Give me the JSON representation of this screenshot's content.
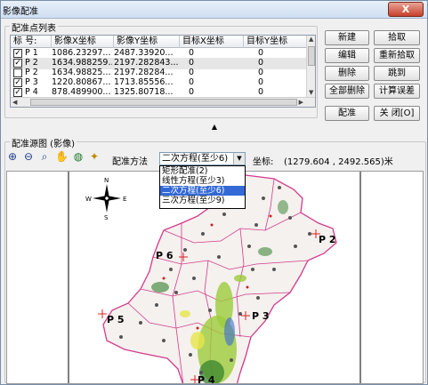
{
  "window": {
    "title": "影像配准",
    "close_label": "X"
  },
  "points_group": {
    "title": "配准点列表",
    "columns": [
      "标 号:",
      "影像X坐标",
      "影像Y坐标",
      "目标X坐标",
      "目标Y坐标"
    ],
    "rows": [
      {
        "checked": true,
        "id": "P 1",
        "img_x": "1086.23297...",
        "img_y": "2487.33920...",
        "tgt_x": "0",
        "tgt_y": "0",
        "selected": false
      },
      {
        "checked": true,
        "id": "P 2",
        "img_x": "1634.988259...",
        "img_y": "2197.282843...",
        "tgt_x": "0",
        "tgt_y": "0",
        "selected": true
      },
      {
        "checked": false,
        "id": "P 2",
        "img_x": "1634.98825...",
        "img_y": "2197.28284...",
        "tgt_x": "0",
        "tgt_y": "0",
        "selected": false
      },
      {
        "checked": true,
        "id": "P 3",
        "img_x": "1220.80867...",
        "img_y": "1713.85556...",
        "tgt_x": "0",
        "tgt_y": "0",
        "selected": false
      },
      {
        "checked": true,
        "id": "P 4",
        "img_x": "878.489900...",
        "img_y": "1325.80718...",
        "tgt_x": "0",
        "tgt_y": "0",
        "selected": false
      }
    ]
  },
  "buttons": {
    "new": "新建",
    "pick": "拾取",
    "edit": "编辑",
    "repick": "重新拾取",
    "delete": "删除",
    "goto": "跳到",
    "delete_all": "全部删除",
    "calc_error": "计算误差",
    "register": "配准",
    "close": "关 闭[O]"
  },
  "source_group": {
    "title": "配准源图 (影像)"
  },
  "toolbar": {
    "icons": [
      "zoom-in-icon",
      "zoom-out-icon",
      "zoom-extent-icon",
      "pan-hand-icon",
      "refresh-icon",
      "pick-point-icon"
    ],
    "method_label": "配准方法",
    "method_value": "二次方程(至少6)",
    "method_options": [
      "矩形配准(2)",
      "线性方程(至少3)",
      "二次方程(至少6)",
      "三次方程(至少9)"
    ],
    "method_selected_index": 2,
    "coord_label": "坐标:",
    "coord_value": "(1279.604 , 2492.565)米"
  },
  "map": {
    "compass_labels": {
      "north": "N",
      "south": "S",
      "east": "E",
      "west": "W"
    },
    "points": [
      "P 2",
      "P 6",
      "P 3",
      "P 5",
      "P 4"
    ],
    "colors": {
      "boundary": "#d43a8c",
      "forest": "#2f7d2a",
      "green": "#9ccc3b",
      "yellow": "#e7e64a",
      "blue": "#3a6ad4"
    }
  }
}
